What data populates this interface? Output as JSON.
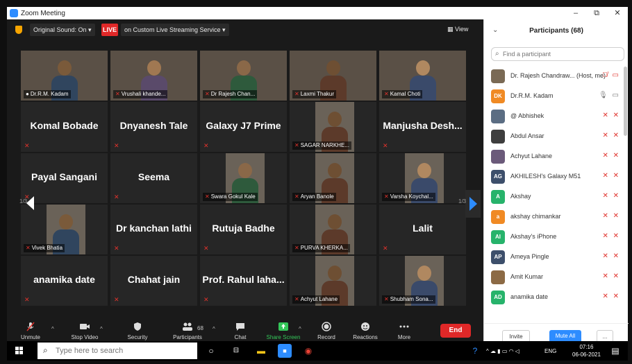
{
  "window": {
    "title": "Zoom Meeting",
    "min": "–",
    "restore": "⧉",
    "close": "✕"
  },
  "topbar": {
    "original_sound": "Original Sound: On ▾",
    "live": "LIVE",
    "live_service": "on Custom Live Streaming Service ▾",
    "view": "▦ View"
  },
  "grid": {
    "page_left": "1/3",
    "page_right": "1/3",
    "tiles": [
      {
        "name": "Dr.R.M. Kadam",
        "type": "video",
        "mic": "on"
      },
      {
        "name": "Vrushali khande...",
        "type": "video"
      },
      {
        "name": "Dr Rajesh Chan...",
        "type": "video"
      },
      {
        "name": "Laxmi Thakur",
        "type": "video"
      },
      {
        "name": "Kamal Choti",
        "type": "video"
      },
      {
        "name": "Komal Bobade",
        "type": "name"
      },
      {
        "name": "Dnyanesh Tale",
        "type": "name"
      },
      {
        "name": "Galaxy J7 Prime",
        "type": "name"
      },
      {
        "name": "SAGAR NARKHE...",
        "type": "video"
      },
      {
        "name": "Manjusha Desh...",
        "type": "name"
      },
      {
        "name": "Payal Sangani",
        "type": "name"
      },
      {
        "name": "Seema",
        "type": "name"
      },
      {
        "name": "Swara Gokul Kale",
        "type": "video"
      },
      {
        "name": "Aryan Banole",
        "type": "video"
      },
      {
        "name": "Varsha Koychal...",
        "type": "video"
      },
      {
        "name": "Vivek Bhatia",
        "type": "video"
      },
      {
        "name": "Dr kanchan lathi",
        "type": "name"
      },
      {
        "name": "Rutuja Badhe",
        "type": "name"
      },
      {
        "name": "PURVA KHERKA...",
        "type": "video"
      },
      {
        "name": "Lalit",
        "type": "name"
      },
      {
        "name": "anamika date",
        "type": "name"
      },
      {
        "name": "Chahat jain",
        "type": "name"
      },
      {
        "name": "Prof. Rahul laha...",
        "type": "name"
      },
      {
        "name": "Achyut Lahane",
        "type": "video"
      },
      {
        "name": "Shubham Sona...",
        "type": "video"
      }
    ]
  },
  "toolbar": {
    "unmute": "Unmute",
    "stop_video": "Stop Video",
    "security": "Security",
    "participants": "Participants",
    "participant_count": "68",
    "chat": "Chat",
    "share_screen": "Share Screen",
    "record": "Record",
    "reactions": "Reactions",
    "more": "More",
    "end": "End"
  },
  "panel": {
    "title": "Participants (68)",
    "find_placeholder": "Find a participant",
    "invite": "Invite",
    "mute_all": "Mute All",
    "more": "...",
    "participants": [
      {
        "name": "Dr. Rajesh Chandraw... (Host, me)",
        "initials": "",
        "color": "#7a6a55",
        "photo": true,
        "status": "🎙̸ ▭"
      },
      {
        "name": "Dr.R.M. Kadam",
        "initials": "DK",
        "color": "#f08a24",
        "photo": false,
        "status": "🎙 ▭"
      },
      {
        "name": "@ Abhishek",
        "initials": "",
        "color": "#5b6d83",
        "photo": true,
        "status": "✕ ✕"
      },
      {
        "name": "Abdul Ansar",
        "initials": "",
        "color": "#3e3e3e",
        "photo": true,
        "status": "✕ ✕"
      },
      {
        "name": "Achyut Lahane",
        "initials": "",
        "color": "#6b5a7a",
        "photo": true,
        "status": "✕ ✕"
      },
      {
        "name": "AKHILESH's Galaxy M51",
        "initials": "AG",
        "color": "#3d4f6b",
        "photo": false,
        "status": "✕ ✕"
      },
      {
        "name": "Akshay",
        "initials": "A",
        "color": "#27b36b",
        "photo": false,
        "status": "✕ ✕"
      },
      {
        "name": "akshay chimankar",
        "initials": "a",
        "color": "#f08a24",
        "photo": false,
        "status": "✕ ✕"
      },
      {
        "name": "Akshay's iPhone",
        "initials": "AI",
        "color": "#27b36b",
        "photo": false,
        "status": "✕ ✕"
      },
      {
        "name": "Ameya Pingle",
        "initials": "AP",
        "color": "#3d4f6b",
        "photo": false,
        "status": "✕ ✕"
      },
      {
        "name": "Amit Kumar",
        "initials": "",
        "color": "#8c6a45",
        "photo": true,
        "status": "✕ ✕"
      },
      {
        "name": "anamika date",
        "initials": "AD",
        "color": "#27b36b",
        "photo": false,
        "status": "✕ ✕"
      }
    ]
  },
  "taskbar": {
    "search_placeholder": "Type here to search",
    "lang": "ENG",
    "time": "07:16",
    "date": "06-06-2021"
  }
}
